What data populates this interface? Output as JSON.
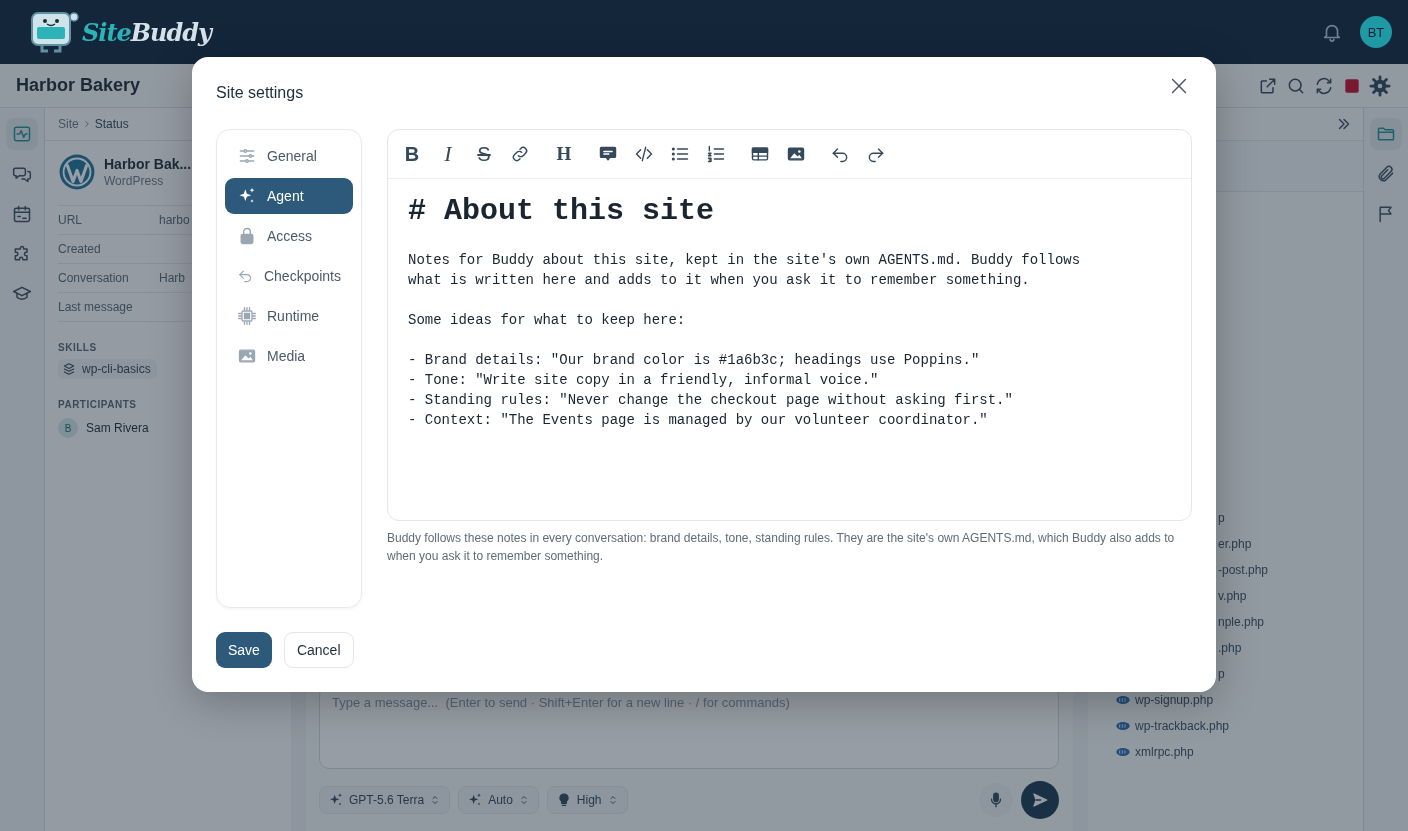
{
  "top_bar": {
    "logo_words": [
      "Site",
      "Buddy"
    ],
    "avatar": "BT"
  },
  "site_header": {
    "title": "Harbor Bakery"
  },
  "left_rail": [
    {
      "selected": true
    },
    {
      "selected": false
    },
    {
      "selected": false
    },
    {
      "selected": false
    },
    {
      "selected": false
    }
  ],
  "left_panel": {
    "breadcrumb": [
      "Site",
      "Status"
    ],
    "site": {
      "name": "Harbor Bak...",
      "platform": "WordPress"
    },
    "details": [
      {
        "label": "URL",
        "value": "harbo"
      },
      {
        "label": "Created"
      },
      {
        "label": "Conversation",
        "value": "Harb"
      },
      {
        "label": "Last message"
      }
    ],
    "skills_heading": "SKILLS",
    "skills": [
      "wp-cli-basics"
    ],
    "participants_heading": "PARTICIPANTS",
    "participants": [
      {
        "initial": "B",
        "name": "Sam Rivera"
      }
    ]
  },
  "chat": {
    "placeholder": "Type a message...  (Enter to send · Shift+Enter for a new line · / for commands)",
    "chips": [
      "GPT-5.6 Terra",
      "Auto",
      "High"
    ]
  },
  "files_panel": {
    "files": [
      {
        "name": "p",
        "clipped": true
      },
      {
        "name": "er.php",
        "clipped": true
      },
      {
        "name": "-post.php",
        "clipped": true
      },
      {
        "name": "v.php",
        "clipped": true
      },
      {
        "name": "nple.php",
        "clipped": true
      },
      {
        "name": ".php",
        "clipped": true
      },
      {
        "name": "p",
        "clipped": true
      },
      {
        "name": "wp-signup.php",
        "clipped": false
      },
      {
        "name": "wp-trackback.php",
        "clipped": false
      },
      {
        "name": "xmlrpc.php",
        "clipped": false
      }
    ]
  },
  "right_rail": [
    {
      "selected": true
    },
    {
      "selected": false
    },
    {
      "selected": false
    }
  ],
  "modal": {
    "title": "Site settings",
    "nav": [
      {
        "label": "General",
        "selected": false
      },
      {
        "label": "Agent",
        "selected": true
      },
      {
        "label": "Access",
        "selected": false
      },
      {
        "label": "Checkpoints",
        "selected": false
      },
      {
        "label": "Runtime",
        "selected": false
      },
      {
        "label": "Media",
        "selected": false
      }
    ],
    "editor": {
      "toolbar": [
        [
          {
            "kind": "bold",
            "label": "B"
          },
          {
            "kind": "italic",
            "label": "I"
          },
          {
            "kind": "strike",
            "label": "S"
          },
          {
            "kind": "link"
          }
        ],
        [
          {
            "kind": "heading",
            "label": "H"
          }
        ],
        [
          {
            "kind": "comment"
          },
          {
            "kind": "code"
          },
          {
            "kind": "bullets"
          },
          {
            "kind": "numbers"
          }
        ],
        [
          {
            "kind": "table"
          },
          {
            "kind": "image"
          }
        ],
        [
          {
            "kind": "undo"
          },
          {
            "kind": "redo"
          }
        ]
      ],
      "heading": "# About this site",
      "paragraphs": [
        [
          "Notes for Buddy about this site, kept in the site's own AGENTS.md. Buddy follows",
          "what is written here and adds to it when you ask it to remember something."
        ],
        [
          "Some ideas for what to keep here:"
        ],
        [
          "- Brand details: \"Our brand color is #1a6b3c; headings use Poppins.\"",
          "- Tone: \"Write site copy in a friendly, informal voice.\"",
          "- Standing rules: \"Never change the checkout page without asking first.\"",
          "- Context: \"The Events page is managed by our volunteer coordinator.\""
        ]
      ]
    },
    "help": "Buddy follows these notes in every conversation: brand details, tone, standing rules. They are the site's own AGENTS.md, which Buddy also adds to when you ask it to remember something.",
    "save": "Save",
    "cancel": "Cancel"
  }
}
